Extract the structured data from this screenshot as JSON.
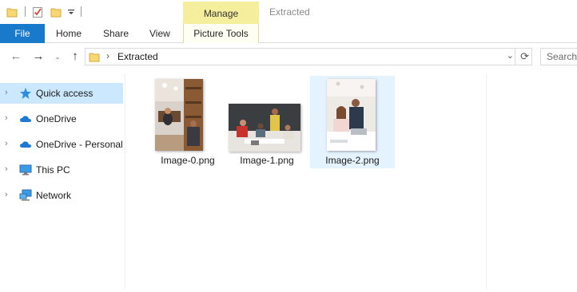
{
  "qat": {
    "icons": [
      "folder-icon",
      "properties-checkmark-icon",
      "new-folder-icon",
      "customize-dropdown-icon"
    ]
  },
  "ribbon": {
    "contextual_header": "Manage",
    "contextual_tab": "Picture Tools",
    "tabs": {
      "file": "File",
      "home": "Home",
      "share": "Share",
      "view": "View"
    }
  },
  "window": {
    "title": "Extracted"
  },
  "address": {
    "path": "Extracted",
    "search_placeholder": "Search"
  },
  "nav": {
    "items": [
      {
        "label": "Quick access",
        "icon": "star-icon",
        "selected": true
      },
      {
        "label": "OneDrive",
        "icon": "cloud-icon",
        "selected": false
      },
      {
        "label": "OneDrive - Personal",
        "icon": "cloud-icon",
        "selected": false
      },
      {
        "label": "This PC",
        "icon": "monitor-icon",
        "selected": false
      },
      {
        "label": "Network",
        "icon": "network-icon",
        "selected": false
      }
    ]
  },
  "files": [
    {
      "name": "Image-0.png",
      "selected": false
    },
    {
      "name": "Image-1.png",
      "selected": false
    },
    {
      "name": "Image-2.png",
      "selected": true
    }
  ],
  "colors": {
    "file_tab": "#1979ca",
    "manage_tab": "#f5ee9c",
    "selection": "#cce8ff",
    "folder": "#f8d775"
  }
}
